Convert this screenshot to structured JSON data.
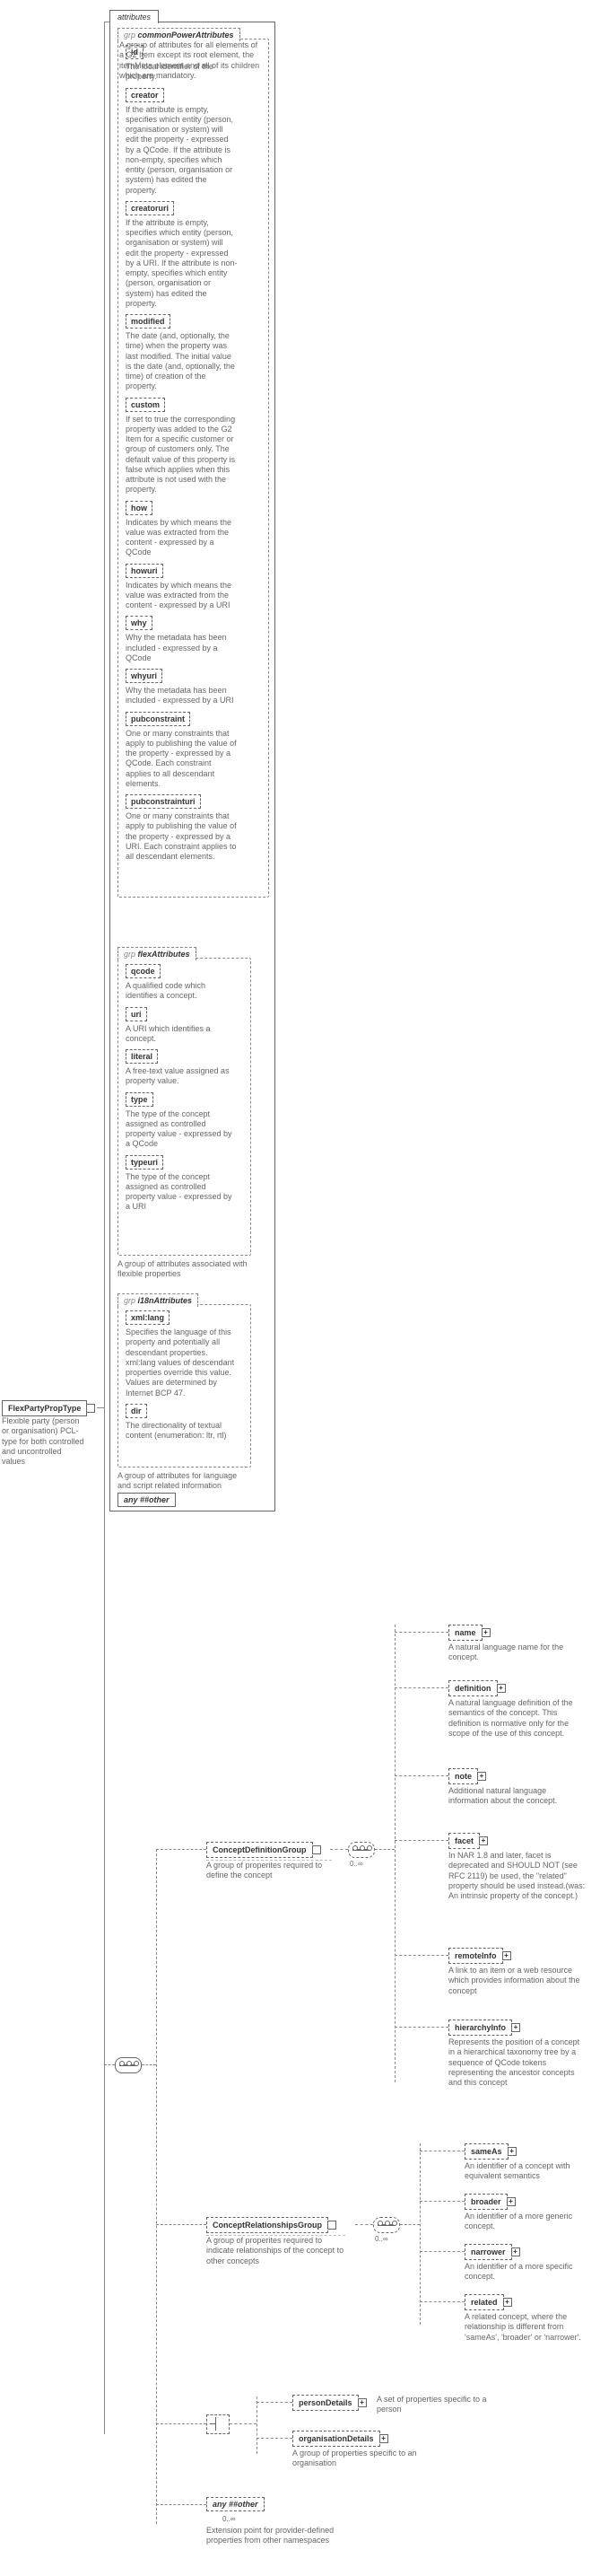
{
  "root": {
    "name": "FlexPartyPropType",
    "desc": "Flexible party (person or organisation) PCL-type for both controlled and uncontrolled values"
  },
  "attributes_label": "attributes",
  "groups": {
    "common": {
      "label": "commonPowerAttributes",
      "desc": "A group of attributes for all elements of a G2 Item except its root element, the itemMeta element and all of its children which are mandatory.",
      "attrs": [
        {
          "name": "id",
          "desc": "The local identifier of the property."
        },
        {
          "name": "creator",
          "desc": "If the attribute is empty, specifies which entity (person, organisation or system) will edit the property - expressed by a QCode. If the attribute is non-empty, specifies which entity (person, organisation or system) has edited the property."
        },
        {
          "name": "creatoruri",
          "desc": "If the attribute is empty, specifies which entity (person, organisation or system) will edit the property - expressed by a URI. If the attribute is non-empty, specifies which entity (person, organisation or system) has edited the property."
        },
        {
          "name": "modified",
          "desc": "The date (and, optionally, the time) when the property was last modified. The initial value is the date (and, optionally, the time) of creation of the property."
        },
        {
          "name": "custom",
          "desc": "If set to true the corresponding property was added to the G2 Item for a specific customer or group of customers only. The default value of this property is false which applies when this attribute is not used with the property."
        },
        {
          "name": "how",
          "desc": "Indicates by which means the value was extracted from the content - expressed by a QCode"
        },
        {
          "name": "howuri",
          "desc": "Indicates by which means the value was extracted from the content - expressed by a URI"
        },
        {
          "name": "why",
          "desc": "Why the metadata has been included - expressed by a QCode"
        },
        {
          "name": "whyuri",
          "desc": "Why the metadata has been included - expressed by a URI"
        },
        {
          "name": "pubconstraint",
          "desc": "One or many constraints that apply to publishing the value of the property - expressed by a QCode. Each constraint applies to all descendant elements."
        },
        {
          "name": "pubconstrainturi",
          "desc": "One or many constraints that apply to publishing the value of the property - expressed by a URI. Each constraint applies to all descendant elements."
        }
      ]
    },
    "flex": {
      "label": "flexAttributes",
      "desc": "A group of attributes associated with flexible properties",
      "attrs": [
        {
          "name": "qcode",
          "desc": "A qualified code which identifies a concept."
        },
        {
          "name": "uri",
          "desc": "A URI which identifies a concept."
        },
        {
          "name": "literal",
          "desc": "A free-text value assigned as property value."
        },
        {
          "name": "type",
          "desc": "The type of the concept assigned as controlled property value - expressed by a QCode"
        },
        {
          "name": "typeuri",
          "desc": "The type of the concept assigned as controlled property value - expressed by a URI"
        }
      ]
    },
    "i18n": {
      "label": "i18nAttributes",
      "desc": "A group of attributes for language and script related information",
      "attrs": [
        {
          "name": "xml:lang",
          "desc": "Specifies the language of this property and potentially all descendant properties. xml:lang values of descendant properties override this value. Values are determined by Internet BCP 47."
        },
        {
          "name": "dir",
          "desc": "The directionality of textual content (enumeration: ltr, rtl)"
        }
      ]
    }
  },
  "any1": "any ##other",
  "conceptDef": {
    "label": "ConceptDefinitionGroup",
    "desc": "A group of properites required to define the concept",
    "card": "0..∞",
    "children": [
      {
        "name": "name",
        "desc": "A natural language name for the concept."
      },
      {
        "name": "definition",
        "desc": "A natural language definition of the semantics of the concept. This definition is normative only for the scope of the use of this concept."
      },
      {
        "name": "note",
        "desc": "Additional natural language information about the concept."
      },
      {
        "name": "facet",
        "desc": "In NAR 1.8 and later, facet is deprecated and SHOULD NOT (see RFC 2119) be used, the \"related\" property should be used instead.(was: An intrinsic property of the concept.)"
      },
      {
        "name": "remoteInfo",
        "desc": "A link to an item or a web resource which provides information about the concept"
      },
      {
        "name": "hierarchyInfo",
        "desc": "Represents the position of a concept in a hierarchical taxonomy tree by a sequence of QCode tokens representing the ancestor concepts and this concept"
      }
    ]
  },
  "conceptRel": {
    "label": "ConceptRelationshipsGroup",
    "desc": "A group of properites required to indicate relationships of the concept to other concepts",
    "card": "0..∞",
    "children": [
      {
        "name": "sameAs",
        "desc": "An identifier of a concept with equivalent semantics"
      },
      {
        "name": "broader",
        "desc": "An identifier of a more generic concept."
      },
      {
        "name": "narrower",
        "desc": "An identifier of a more specific concept."
      },
      {
        "name": "related",
        "desc": "A related concept, where the relationship is different from 'sameAs', 'broader' or 'narrower'."
      }
    ]
  },
  "personDetails": {
    "name": "personDetails",
    "desc": "A set of properties specific to a person"
  },
  "orgDetails": {
    "name": "organisationDetails",
    "desc": "A group of properties specific to an organisation"
  },
  "any2": {
    "label": "any ##other",
    "card": "0..∞",
    "desc": "Extension point for provider-defined properties from other namespaces"
  },
  "chart_data": {
    "type": "table",
    "note": "XML Schema diagram – structural, no quantitative chart data"
  }
}
